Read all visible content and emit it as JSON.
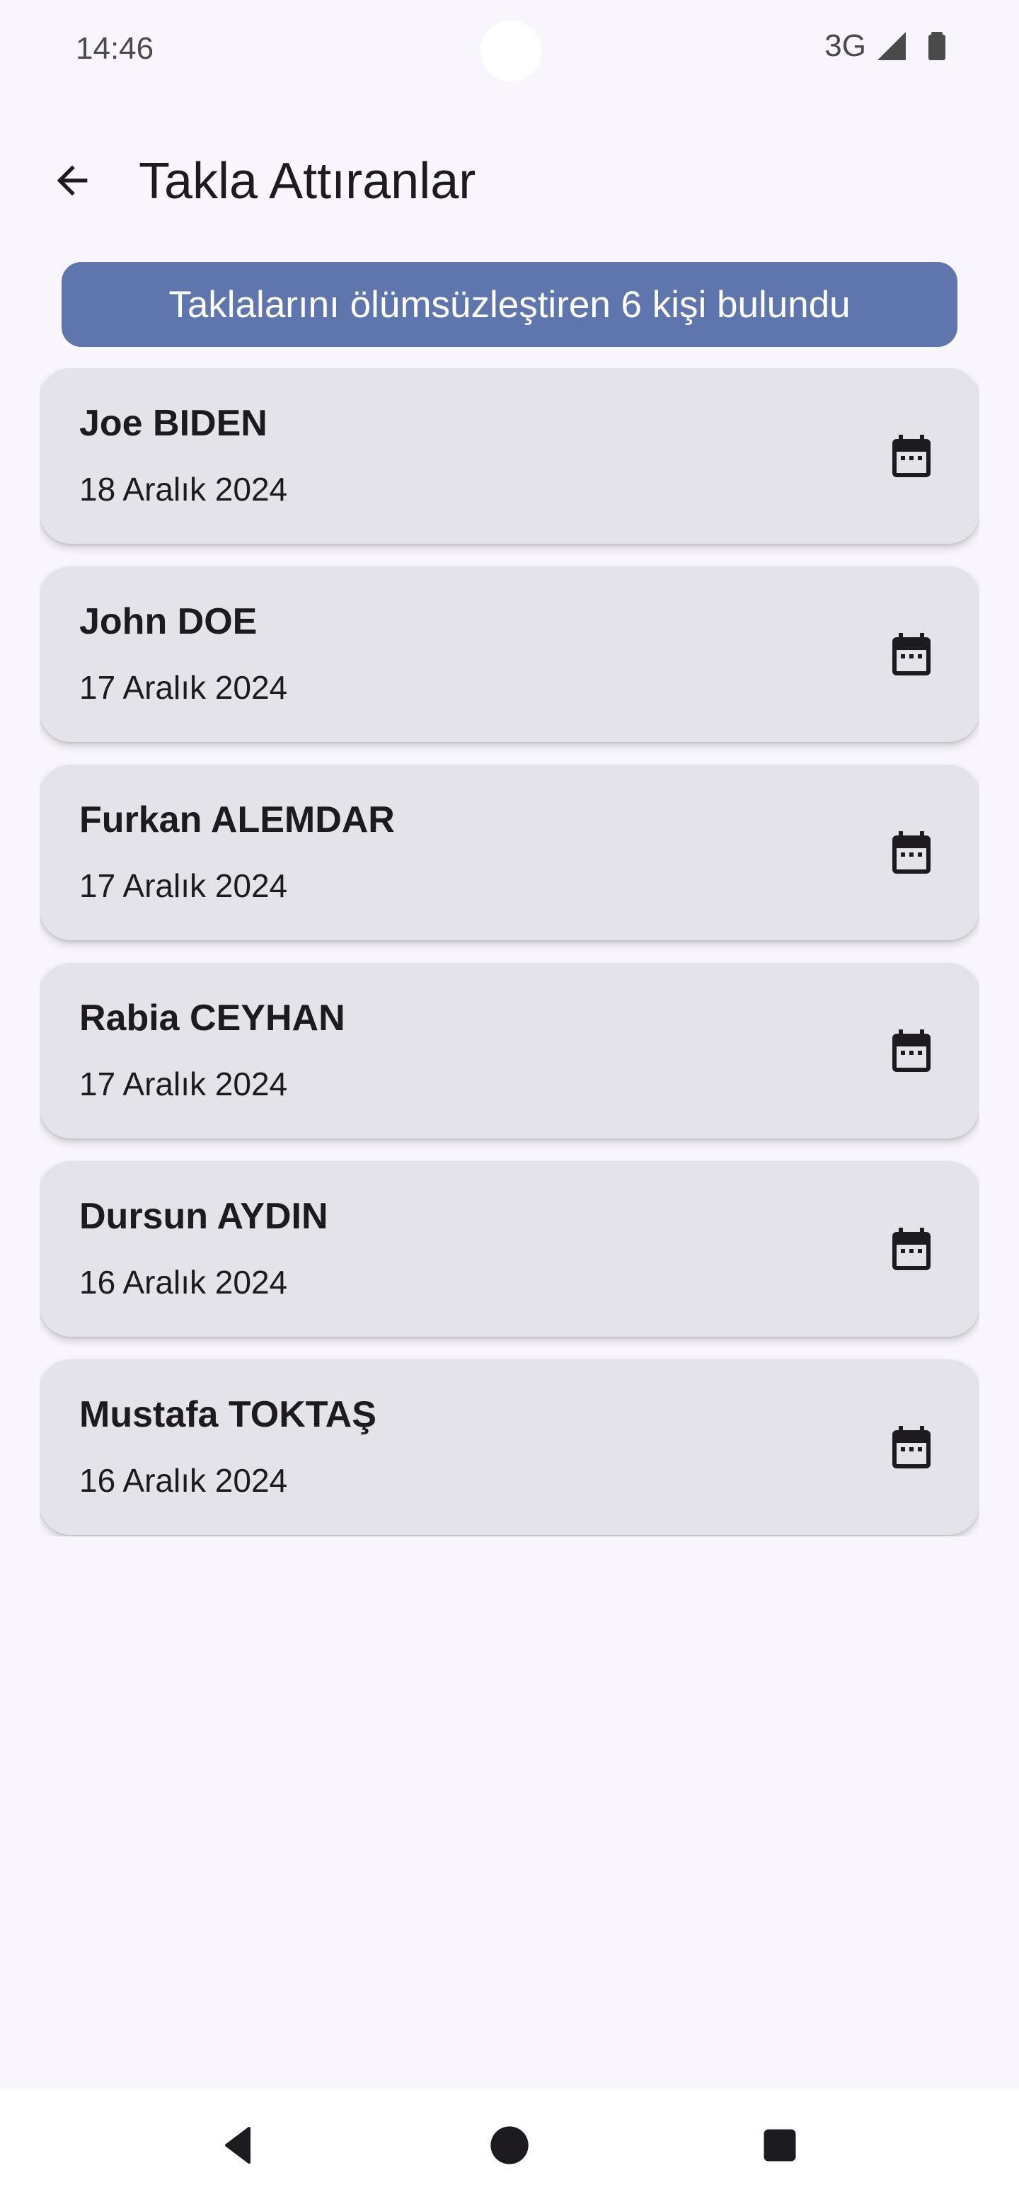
{
  "status_bar": {
    "time": "14:46",
    "network": "3G"
  },
  "app_bar": {
    "title": "Takla Attıranlar"
  },
  "banner": {
    "text": "Taklalarını ölümsüzleştiren 6 kişi bulundu"
  },
  "people": [
    {
      "name": "Joe BIDEN",
      "date": "18 Aralık 2024"
    },
    {
      "name": "John DOE",
      "date": "17 Aralık 2024"
    },
    {
      "name": "Furkan ALEMDAR",
      "date": "17 Aralık 2024"
    },
    {
      "name": "Rabia CEYHAN",
      "date": "17 Aralık 2024"
    },
    {
      "name": "Dursun AYDIN",
      "date": "16 Aralık 2024"
    },
    {
      "name": "Mustafa TOKTAŞ",
      "date": "16 Aralık 2024"
    }
  ],
  "icons": {
    "back": "arrow-back-icon",
    "card": "calendar-icon",
    "signal": "cellular-signal-icon",
    "battery": "battery-icon",
    "nav_back": "nav-back-icon",
    "nav_home": "nav-home-icon",
    "nav_recents": "nav-recents-icon"
  },
  "colors": {
    "background": "#f8f6fc",
    "banner": "#5f75ae",
    "card": "#e4e3e9",
    "text": "#1d1b20"
  }
}
